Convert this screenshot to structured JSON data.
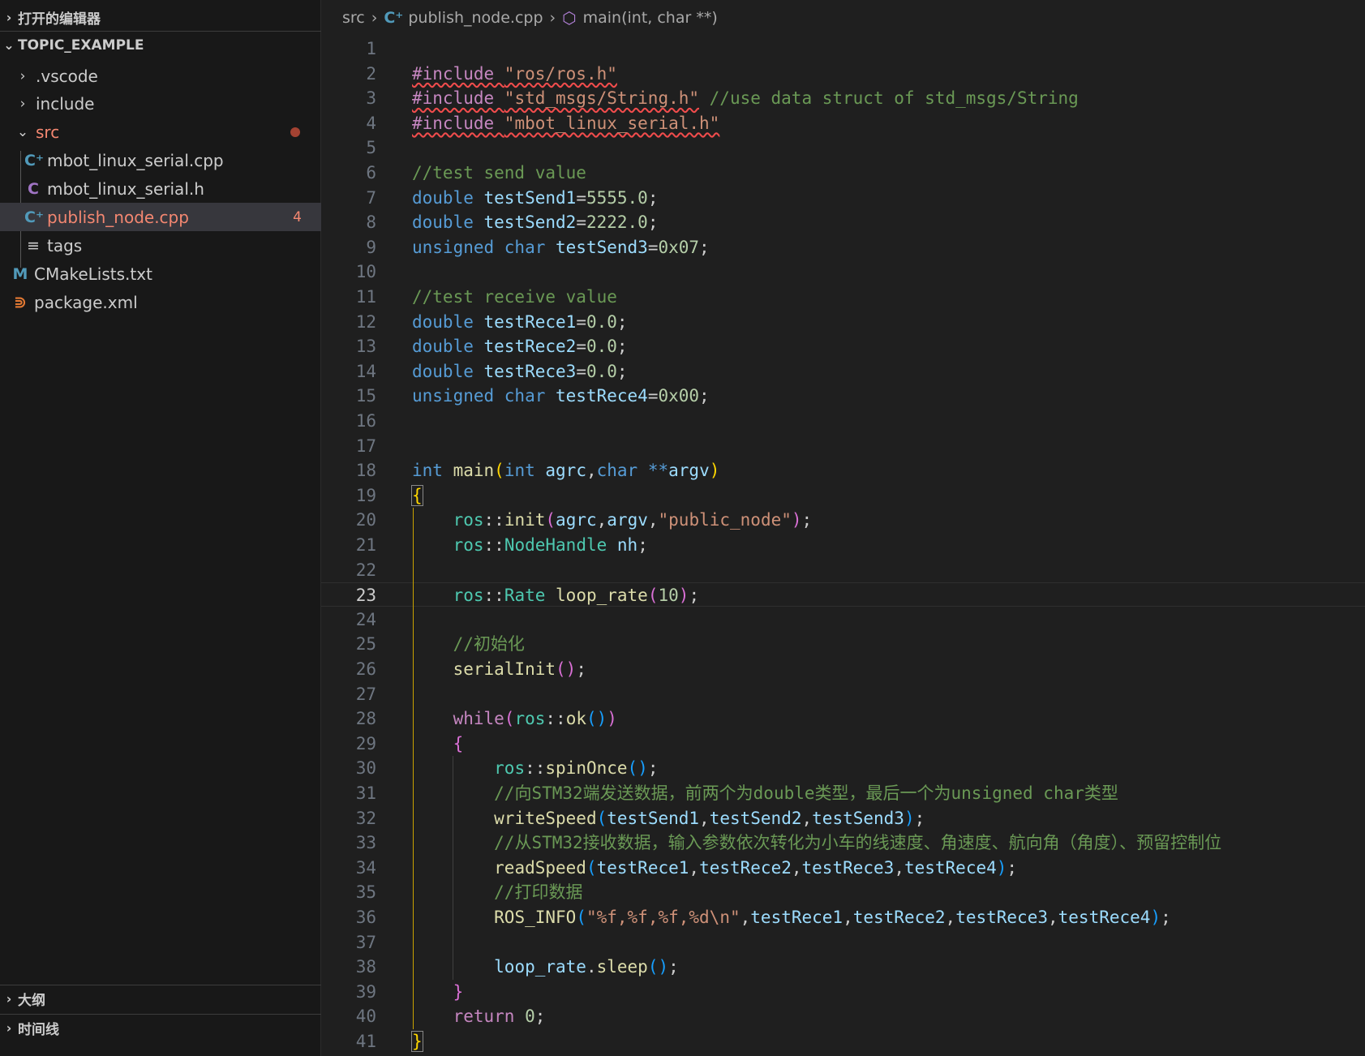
{
  "sidebar": {
    "open_editors_label": "打开的编辑器",
    "project_label": "TOPIC_EXAMPLE",
    "items": [
      {
        "label": ".vscode",
        "badge": ""
      },
      {
        "label": "include",
        "badge": ""
      },
      {
        "label": "src",
        "badge": ""
      },
      {
        "label": "mbot_linux_serial.cpp",
        "badge": ""
      },
      {
        "label": "mbot_linux_serial.h",
        "badge": ""
      },
      {
        "label": "publish_node.cpp",
        "badge": "4"
      },
      {
        "label": "tags",
        "badge": ""
      },
      {
        "label": "CMakeLists.txt",
        "badge": ""
      },
      {
        "label": "package.xml",
        "badge": ""
      }
    ],
    "outline_label": "大纲",
    "timeline_label": "时间线"
  },
  "breadcrumb": {
    "folder": "src",
    "file": "publish_node.cpp",
    "symbol": "main(int, char **)"
  },
  "editor": {
    "line_numbers": [
      "1",
      "2",
      "3",
      "4",
      "5",
      "6",
      "7",
      "8",
      "9",
      "10",
      "11",
      "12",
      "13",
      "14",
      "15",
      "16",
      "17",
      "18",
      "19",
      "20",
      "21",
      "22",
      "23",
      "24",
      "25",
      "26",
      "27",
      "28",
      "29",
      "30",
      "31",
      "32",
      "33",
      "34",
      "35",
      "36",
      "37",
      "38",
      "39",
      "40",
      "41"
    ],
    "current_line": 23,
    "lines": [
      [],
      [
        {
          "t": "#include ",
          "c": "pre err"
        },
        {
          "t": "\"ros/ros.h\"",
          "c": "str err"
        }
      ],
      [
        {
          "t": "#include ",
          "c": "pre err"
        },
        {
          "t": "\"std_msgs/String.h\"",
          "c": "str err"
        },
        {
          "t": " //use data struct of std_msgs/String",
          "c": "cmt"
        }
      ],
      [
        {
          "t": "#include ",
          "c": "pre err"
        },
        {
          "t": "\"mbot_linux_serial.h\"",
          "c": "str err"
        }
      ],
      [],
      [
        {
          "t": "//test send value",
          "c": "cmt"
        }
      ],
      [
        {
          "t": "double ",
          "c": "kw"
        },
        {
          "t": "testSend1",
          "c": "var"
        },
        {
          "t": "=",
          "c": ""
        },
        {
          "t": "5555.0",
          "c": "num"
        },
        {
          "t": ";",
          "c": ""
        }
      ],
      [
        {
          "t": "double ",
          "c": "kw"
        },
        {
          "t": "testSend2",
          "c": "var"
        },
        {
          "t": "=",
          "c": ""
        },
        {
          "t": "2222.0",
          "c": "num"
        },
        {
          "t": ";",
          "c": ""
        }
      ],
      [
        {
          "t": "unsigned char ",
          "c": "kw"
        },
        {
          "t": "testSend3",
          "c": "var"
        },
        {
          "t": "=",
          "c": ""
        },
        {
          "t": "0x07",
          "c": "num"
        },
        {
          "t": ";",
          "c": ""
        }
      ],
      [],
      [
        {
          "t": "//test receive value",
          "c": "cmt"
        }
      ],
      [
        {
          "t": "double ",
          "c": "kw"
        },
        {
          "t": "testRece1",
          "c": "var"
        },
        {
          "t": "=",
          "c": ""
        },
        {
          "t": "0.0",
          "c": "num"
        },
        {
          "t": ";",
          "c": ""
        }
      ],
      [
        {
          "t": "double ",
          "c": "kw"
        },
        {
          "t": "testRece2",
          "c": "var"
        },
        {
          "t": "=",
          "c": ""
        },
        {
          "t": "0.0",
          "c": "num"
        },
        {
          "t": ";",
          "c": ""
        }
      ],
      [
        {
          "t": "double ",
          "c": "kw"
        },
        {
          "t": "testRece3",
          "c": "var"
        },
        {
          "t": "=",
          "c": ""
        },
        {
          "t": "0.0",
          "c": "num"
        },
        {
          "t": ";",
          "c": ""
        }
      ],
      [
        {
          "t": "unsigned char ",
          "c": "kw"
        },
        {
          "t": "testRece4",
          "c": "var"
        },
        {
          "t": "=",
          "c": ""
        },
        {
          "t": "0x00",
          "c": "num"
        },
        {
          "t": ";",
          "c": ""
        }
      ],
      [],
      [],
      [
        {
          "t": "int ",
          "c": "kw"
        },
        {
          "t": "main",
          "c": "fn"
        },
        {
          "t": "(",
          "c": "br1"
        },
        {
          "t": "int ",
          "c": "kw"
        },
        {
          "t": "agrc",
          "c": "var"
        },
        {
          "t": ",",
          "c": ""
        },
        {
          "t": "char ",
          "c": "kw"
        },
        {
          "t": "**",
          "c": "kw"
        },
        {
          "t": "argv",
          "c": "var"
        },
        {
          "t": ")",
          "c": "br1"
        }
      ],
      [
        {
          "t": "{",
          "c": "br1 brmatch"
        }
      ],
      [
        {
          "t": "    ",
          "c": ""
        },
        {
          "t": "ros",
          "c": "ns"
        },
        {
          "t": "::",
          "c": ""
        },
        {
          "t": "init",
          "c": "fn"
        },
        {
          "t": "(",
          "c": "br2"
        },
        {
          "t": "agrc",
          "c": "var"
        },
        {
          "t": ",",
          "c": ""
        },
        {
          "t": "argv",
          "c": "var"
        },
        {
          "t": ",",
          "c": ""
        },
        {
          "t": "\"public_node\"",
          "c": "str"
        },
        {
          "t": ")",
          "c": "br2"
        },
        {
          "t": ";",
          "c": ""
        }
      ],
      [
        {
          "t": "    ",
          "c": ""
        },
        {
          "t": "ros",
          "c": "ns"
        },
        {
          "t": "::",
          "c": ""
        },
        {
          "t": "NodeHandle ",
          "c": "typ"
        },
        {
          "t": "nh",
          "c": "var"
        },
        {
          "t": ";",
          "c": ""
        }
      ],
      [],
      [
        {
          "t": "    ",
          "c": ""
        },
        {
          "t": "ros",
          "c": "ns"
        },
        {
          "t": "::",
          "c": ""
        },
        {
          "t": "Rate ",
          "c": "typ"
        },
        {
          "t": "loop_rate",
          "c": "fn"
        },
        {
          "t": "(",
          "c": "br2"
        },
        {
          "t": "10",
          "c": "num"
        },
        {
          "t": ")",
          "c": "br2"
        },
        {
          "t": ";",
          "c": ""
        }
      ],
      [],
      [
        {
          "t": "    ",
          "c": ""
        },
        {
          "t": "//初始化",
          "c": "cmt"
        }
      ],
      [
        {
          "t": "    ",
          "c": ""
        },
        {
          "t": "serialInit",
          "c": "fn"
        },
        {
          "t": "()",
          "c": "br2"
        },
        {
          "t": ";",
          "c": ""
        }
      ],
      [],
      [
        {
          "t": "    ",
          "c": ""
        },
        {
          "t": "while",
          "c": "ctrl"
        },
        {
          "t": "(",
          "c": "br2"
        },
        {
          "t": "ros",
          "c": "ns"
        },
        {
          "t": "::",
          "c": ""
        },
        {
          "t": "ok",
          "c": "fn"
        },
        {
          "t": "()",
          "c": "br3"
        },
        {
          "t": ")",
          "c": "br2"
        }
      ],
      [
        {
          "t": "    ",
          "c": ""
        },
        {
          "t": "{",
          "c": "br2"
        }
      ],
      [
        {
          "t": "        ",
          "c": ""
        },
        {
          "t": "ros",
          "c": "ns"
        },
        {
          "t": "::",
          "c": ""
        },
        {
          "t": "spinOnce",
          "c": "fn"
        },
        {
          "t": "()",
          "c": "br3"
        },
        {
          "t": ";",
          "c": ""
        }
      ],
      [
        {
          "t": "        ",
          "c": ""
        },
        {
          "t": "//向STM32端发送数据，前两个为double类型，最后一个为unsigned char类型",
          "c": "cmt"
        }
      ],
      [
        {
          "t": "        ",
          "c": ""
        },
        {
          "t": "writeSpeed",
          "c": "fn"
        },
        {
          "t": "(",
          "c": "br3"
        },
        {
          "t": "testSend1",
          "c": "var"
        },
        {
          "t": ",",
          "c": ""
        },
        {
          "t": "testSend2",
          "c": "var"
        },
        {
          "t": ",",
          "c": ""
        },
        {
          "t": "testSend3",
          "c": "var"
        },
        {
          "t": ")",
          "c": "br3"
        },
        {
          "t": ";",
          "c": ""
        }
      ],
      [
        {
          "t": "        ",
          "c": ""
        },
        {
          "t": "//从STM32接收数据，输入参数依次转化为小车的线速度、角速度、航向角（角度）、预留控制位",
          "c": "cmt"
        }
      ],
      [
        {
          "t": "        ",
          "c": ""
        },
        {
          "t": "readSpeed",
          "c": "fn"
        },
        {
          "t": "(",
          "c": "br3"
        },
        {
          "t": "testRece1",
          "c": "var"
        },
        {
          "t": ",",
          "c": ""
        },
        {
          "t": "testRece2",
          "c": "var"
        },
        {
          "t": ",",
          "c": ""
        },
        {
          "t": "testRece3",
          "c": "var"
        },
        {
          "t": ",",
          "c": ""
        },
        {
          "t": "testRece4",
          "c": "var"
        },
        {
          "t": ")",
          "c": "br3"
        },
        {
          "t": ";",
          "c": ""
        }
      ],
      [
        {
          "t": "        ",
          "c": ""
        },
        {
          "t": "//打印数据",
          "c": "cmt"
        }
      ],
      [
        {
          "t": "        ",
          "c": ""
        },
        {
          "t": "ROS_INFO",
          "c": "fn"
        },
        {
          "t": "(",
          "c": "br3"
        },
        {
          "t": "\"%f,%f,%f,%d\\n\"",
          "c": "str"
        },
        {
          "t": ",",
          "c": ""
        },
        {
          "t": "testRece1",
          "c": "var"
        },
        {
          "t": ",",
          "c": ""
        },
        {
          "t": "testRece2",
          "c": "var"
        },
        {
          "t": ",",
          "c": ""
        },
        {
          "t": "testRece3",
          "c": "var"
        },
        {
          "t": ",",
          "c": ""
        },
        {
          "t": "testRece4",
          "c": "var"
        },
        {
          "t": ")",
          "c": "br3"
        },
        {
          "t": ";",
          "c": ""
        }
      ],
      [],
      [
        {
          "t": "        ",
          "c": ""
        },
        {
          "t": "loop_rate",
          "c": "var"
        },
        {
          "t": ".",
          "c": ""
        },
        {
          "t": "sleep",
          "c": "fn"
        },
        {
          "t": "()",
          "c": "br3"
        },
        {
          "t": ";",
          "c": ""
        }
      ],
      [
        {
          "t": "    ",
          "c": ""
        },
        {
          "t": "}",
          "c": "br2"
        }
      ],
      [
        {
          "t": "    ",
          "c": ""
        },
        {
          "t": "return ",
          "c": "ctrl"
        },
        {
          "t": "0",
          "c": "num"
        },
        {
          "t": ";",
          "c": ""
        }
      ],
      [
        {
          "t": "}",
          "c": "br1 brmatch"
        }
      ]
    ]
  }
}
